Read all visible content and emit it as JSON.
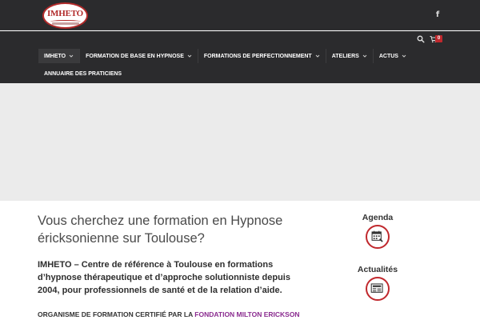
{
  "header": {
    "logo": {
      "wordmark": "IMHETO",
      "brand_color": "#b12a2a"
    },
    "social": {
      "facebook_icon": "facebook-icon"
    },
    "utilities": {
      "search_icon": "search-icon",
      "cart_icon": "cart-icon",
      "cart_count": "0",
      "badge_color": "#c0282d"
    }
  },
  "nav": {
    "items": [
      {
        "label": "IMHETO",
        "has_dropdown": true
      },
      {
        "label": "FORMATION DE BASE EN HYPNOSE",
        "has_dropdown": true
      },
      {
        "label": "FORMATIONS DE PERFECTIONNEMENT",
        "has_dropdown": true
      },
      {
        "label": "ATELIERS",
        "has_dropdown": true
      },
      {
        "label": "ACTUS",
        "has_dropdown": true
      }
    ],
    "row2": [
      {
        "label": "ANNUAIRE DES PRATICIENS",
        "has_dropdown": false
      }
    ]
  },
  "main": {
    "headline": "Vous cherchez une formation en Hypnose éricksonienne sur Toulouse?",
    "intro": "IMHETO – Centre de référence à Toulouse en formations d’hypnose thérapeutique et d’approche solutionniste depuis 2004, pour professionnels de santé et de la relation d’aide.",
    "cert_prefix": "ORGANISME DE FORMATION CERTIFIÉ PAR LA ",
    "cert_link": "FONDATION MILTON ERICKSON",
    "link_color": "#8a2b8f"
  },
  "sidebar": {
    "widgets": [
      {
        "title": "Agenda",
        "icon": "calendar-icon"
      },
      {
        "title": "Actualités",
        "icon": "newspaper-icon"
      }
    ]
  }
}
